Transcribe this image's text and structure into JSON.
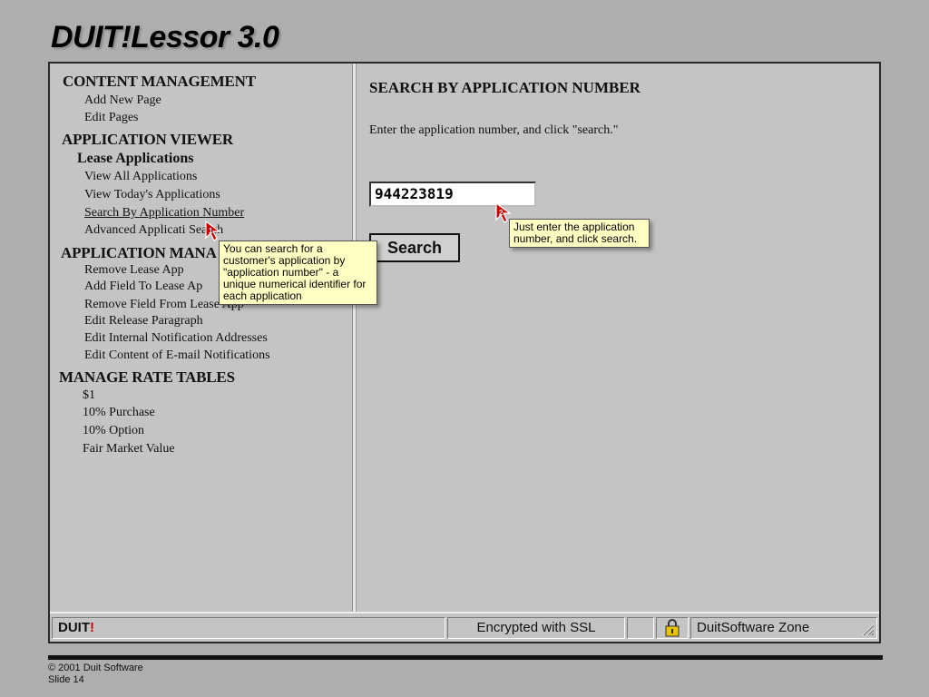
{
  "slide": {
    "title": "DUIT!Lessor 3.0",
    "footer_copyright": "© 2001 Duit Software",
    "footer_slide": "Slide 14"
  },
  "sidebar": {
    "sections": [
      {
        "label": "CONTENT MANAGEMENT",
        "items": [
          "Add New Page",
          "Edit Pages"
        ]
      },
      {
        "label": "APPLICATION VIEWER",
        "sub_label": "Lease Applications",
        "items": [
          "View All Applications",
          "View Today's Applications",
          "Search By Application Number",
          "Advanced Applicati Search"
        ]
      },
      {
        "label": "APPLICATION MANA",
        "items": [
          "Remove Lease App",
          "Add Field To Lease Ap",
          "Remove Field From Lease App",
          "Edit Release Paragraph",
          "Edit Internal Notification Addresses",
          "Edit Content of E-mail Notifications"
        ]
      },
      {
        "label": "MANAGE RATE TABLES",
        "items": [
          "$1",
          "10% Purchase",
          "10% Option",
          "Fair Market Value"
        ]
      }
    ]
  },
  "main": {
    "title": "SEARCH BY APPLICATION NUMBER",
    "instruction": "Enter the application number, and click \"search.\"",
    "app_number_value": "944223819",
    "search_label": "Search"
  },
  "tooltips": {
    "tip1": "You can search for a customer's application by \"application number\" - a unique numerical identifier for each application",
    "tip2": "Just enter the application number, and click search.",
    "marker1": "1",
    "marker2": "2"
  },
  "statusbar": {
    "brand": "DUIT",
    "brand_bang": "!",
    "ssl": "Encrypted with SSL",
    "zone": "DuitSoftware Zone"
  },
  "colors": {
    "tooltip_bg": "#ffffc4",
    "cursor_red": "#cc0000",
    "background": "#aeaeae"
  }
}
